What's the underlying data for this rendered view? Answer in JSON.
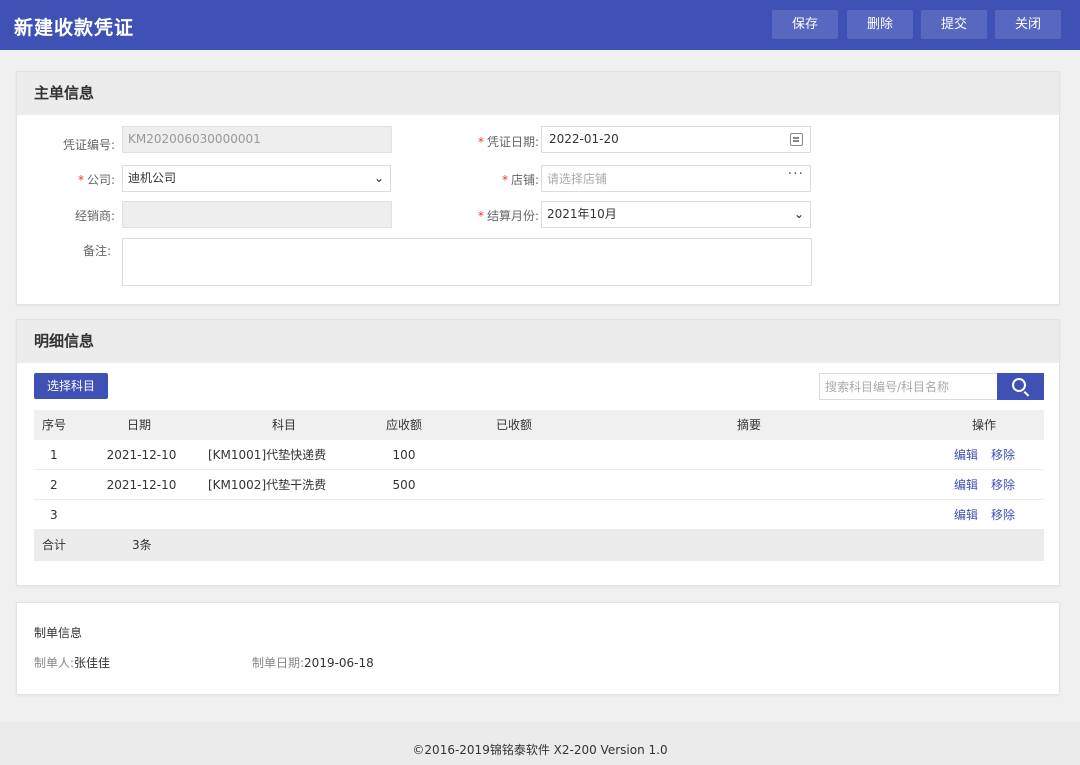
{
  "header": {
    "title": "新建收款凭证",
    "buttons": {
      "save": "保存",
      "delete": "删除",
      "submit": "提交",
      "close": "关闭"
    }
  },
  "master": {
    "title": "主单信息",
    "voucher_no": {
      "label": "凭证编号:",
      "value": "KM202006030000001"
    },
    "voucher_date": {
      "label": "凭证日期:",
      "value": "2022-01-20"
    },
    "company": {
      "label": "公司:",
      "value": "迪机公司"
    },
    "store": {
      "label": "店铺:",
      "placeholder": "请选择店铺",
      "icon": "ellipsis-icon"
    },
    "dealer": {
      "label": "经销商:",
      "value": ""
    },
    "settle_month": {
      "label": "结算月份:",
      "value": "2021年10月"
    },
    "remark": {
      "label": "备注:",
      "value": ""
    },
    "required_mark": "*"
  },
  "detail": {
    "title": "明细信息",
    "select_subject_button": "选择科目",
    "search": {
      "placeholder": "搜索科目编号/科目名称",
      "icon": "search-icon"
    },
    "columns": {
      "seq": "序号",
      "date": "日期",
      "subject": "科目",
      "receivable": "应收额",
      "received": "已收额",
      "summary": "摘要",
      "action": "操作"
    },
    "rows": [
      {
        "seq": "1",
        "date": "2021-12-10",
        "subject": "[KM1001]代垫快递费",
        "receivable": "100",
        "received": "",
        "summary": "",
        "edit": "编辑",
        "remove": "移除"
      },
      {
        "seq": "2",
        "date": "2021-12-10",
        "subject": "[KM1002]代垫干洗费",
        "receivable": "500",
        "received": "",
        "summary": "",
        "edit": "编辑",
        "remove": "移除"
      },
      {
        "seq": "3",
        "date": "",
        "subject": "",
        "receivable": "",
        "received": "",
        "summary": "",
        "edit": "编辑",
        "remove": "移除"
      }
    ],
    "total": {
      "label": "合计",
      "count": "3条"
    }
  },
  "maker": {
    "title": "制单信息",
    "maker_label": "制单人:",
    "maker_value": "张佳佳",
    "date_label": "制单日期:",
    "date_value": "2019-06-18"
  },
  "footer": {
    "copyright": "©2016-2019锦铭泰软件 X2-200 Version 1.0"
  },
  "colors": {
    "primary": "#3f51b5",
    "header_button": "#5867c0",
    "required": "#e53935"
  }
}
